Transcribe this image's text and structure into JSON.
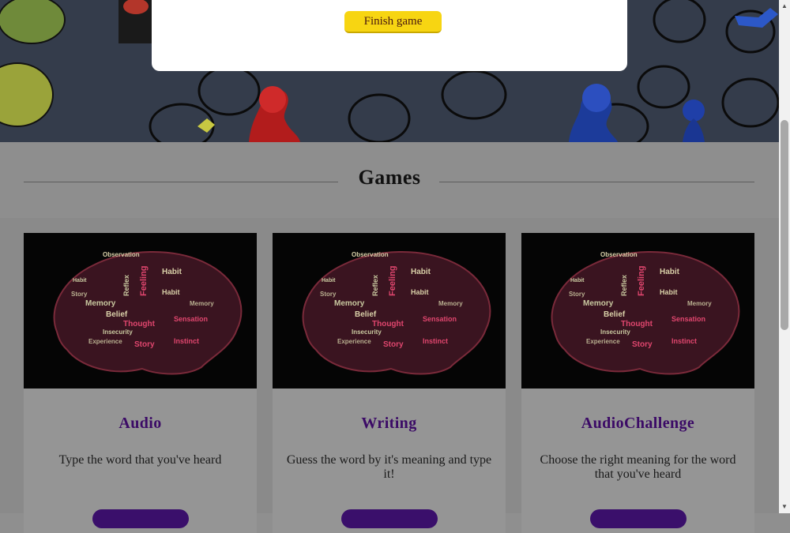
{
  "modal": {
    "finish_label": "Finish game"
  },
  "games": {
    "title": "Games",
    "cards": [
      {
        "title": "Audio",
        "description": "Type the word that you've heard"
      },
      {
        "title": "Writing",
        "description": "Guess the word by it's meaning and type it!"
      },
      {
        "title": "AudioChallenge",
        "description": "Choose the right meaning for the word that you've heard"
      }
    ]
  },
  "colors": {
    "accent": "#f7d512",
    "title": "#3b0a66",
    "button": "#3a0f6b"
  },
  "icons": {
    "scroll_up": "triangle-up-icon",
    "scroll_down": "triangle-down-icon"
  }
}
